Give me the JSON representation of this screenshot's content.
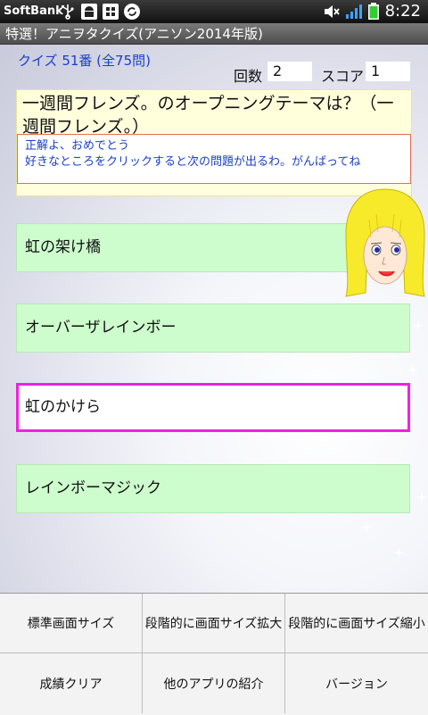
{
  "statusbar": {
    "carrier": "SoftBank",
    "time": "8:22",
    "icons": [
      "usb-icon",
      "android-debug-icon",
      "sd-card-icon",
      "sync-icon",
      "mute-icon",
      "signal-icon",
      "battery-icon"
    ]
  },
  "app": {
    "title": "特選！アニヲタクイズ(アニソン2014年版)"
  },
  "quiz": {
    "number_label": "クイズ 51番 (全75問)",
    "count_label": "回数",
    "count_value": "2",
    "score_label": "スコア",
    "score_value": "1",
    "question": "一週間フレンズ。のオープニングテーマは？（一週間フレンズ。）",
    "message_line1": "正解よ、おめでとう",
    "message_line2": "好きなところをクリックすると次の問題が出るわ。がんばってね"
  },
  "answers": [
    {
      "label": "虹の架け橋",
      "selected": false
    },
    {
      "label": "オーバーザレインボー",
      "selected": false
    },
    {
      "label": "虹のかけら",
      "selected": true
    },
    {
      "label": "レインボーマジック",
      "selected": false
    }
  ],
  "menu": {
    "items": [
      {
        "label": "標準画面サイズ"
      },
      {
        "label": "段階的に画面サイズ拡大"
      },
      {
        "label": "段階的に画面サイズ縮小"
      },
      {
        "label": "成績クリア"
      },
      {
        "label": "他のアプリの紹介"
      },
      {
        "label": "バージョン"
      }
    ]
  },
  "colors": {
    "accent_text": "#1a3fc8",
    "answer_bg": "#cdfccd",
    "selected_border": "#ee22dd",
    "question_bg": "#ffffdc",
    "message_border": "#e07050"
  }
}
